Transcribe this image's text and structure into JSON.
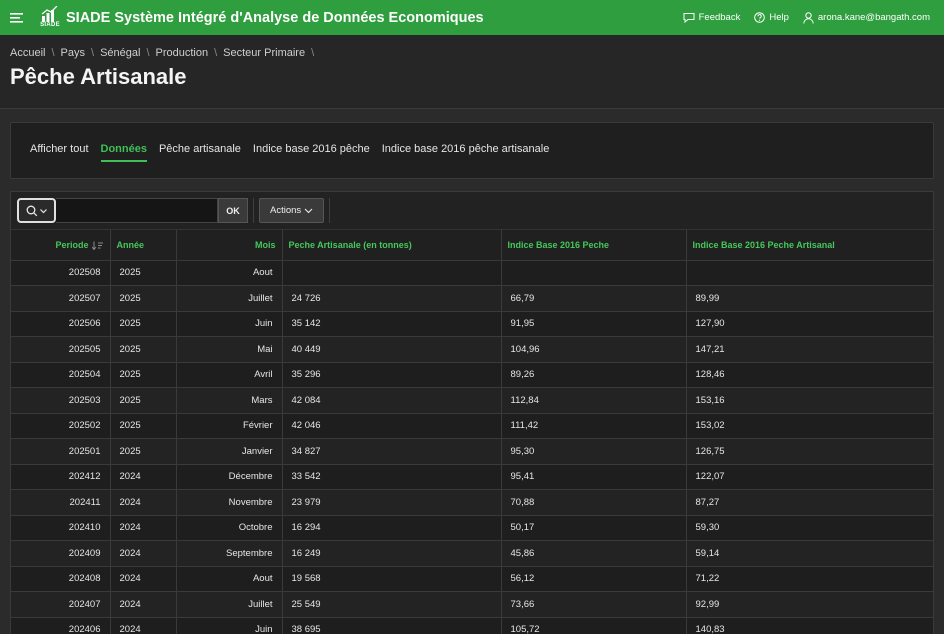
{
  "header": {
    "logo_text": "SIADE",
    "app_title": "SIADE Système Intégré d'Analyse de Données Economiques",
    "feedback_label": "Feedback",
    "help_label": "Help",
    "user_label": "arona.kane@bangath.com"
  },
  "breadcrumb": [
    "Accueil",
    "Pays",
    "Sénégal",
    "Production",
    "Secteur Primaire"
  ],
  "page_title": "Pêche Artisanale",
  "tabs": [
    {
      "label": "Afficher tout",
      "active": false
    },
    {
      "label": "Données",
      "active": true
    },
    {
      "label": "Pêche artisanale",
      "active": false
    },
    {
      "label": "Indice base 2016 pêche",
      "active": false
    },
    {
      "label": "Indice base 2016 pêche artisanale",
      "active": false
    }
  ],
  "toolbar": {
    "search_value": "",
    "ok_label": "OK",
    "actions_label": "Actions"
  },
  "table": {
    "columns": [
      "Periode",
      "Année",
      "Mois",
      "Peche Artisanale (en tonnes)",
      "Indice Base 2016 Peche",
      "Indice Base 2016 Peche Artisanal"
    ],
    "rows": [
      [
        "202508",
        "2025",
        "Aout",
        "",
        "",
        ""
      ],
      [
        "202507",
        "2025",
        "Juillet",
        "24 726",
        "66,79",
        "89,99"
      ],
      [
        "202506",
        "2025",
        "Juin",
        "35 142",
        "91,95",
        "127,90"
      ],
      [
        "202505",
        "2025",
        "Mai",
        "40 449",
        "104,96",
        "147,21"
      ],
      [
        "202504",
        "2025",
        "Avril",
        "35 296",
        "89,26",
        "128,46"
      ],
      [
        "202503",
        "2025",
        "Mars",
        "42 084",
        "112,84",
        "153,16"
      ],
      [
        "202502",
        "2025",
        "Février",
        "42 046",
        "111,42",
        "153,02"
      ],
      [
        "202501",
        "2025",
        "Janvier",
        "34 827",
        "95,30",
        "126,75"
      ],
      [
        "202412",
        "2024",
        "Décembre",
        "33 542",
        "95,41",
        "122,07"
      ],
      [
        "202411",
        "2024",
        "Novembre",
        "23 979",
        "70,88",
        "87,27"
      ],
      [
        "202410",
        "2024",
        "Octobre",
        "16 294",
        "50,17",
        "59,30"
      ],
      [
        "202409",
        "2024",
        "Septembre",
        "16 249",
        "45,86",
        "59,14"
      ],
      [
        "202408",
        "2024",
        "Aout",
        "19 568",
        "56,12",
        "71,22"
      ],
      [
        "202407",
        "2024",
        "Juillet",
        "25 549",
        "73,66",
        "92,99"
      ],
      [
        "202406",
        "2024",
        "Juin",
        "38 695",
        "105,72",
        "140,83"
      ]
    ]
  },
  "colors": {
    "header_bg": "#2e9e3e",
    "accent": "#3fbf55",
    "page_bg": "#2b2b2b"
  }
}
